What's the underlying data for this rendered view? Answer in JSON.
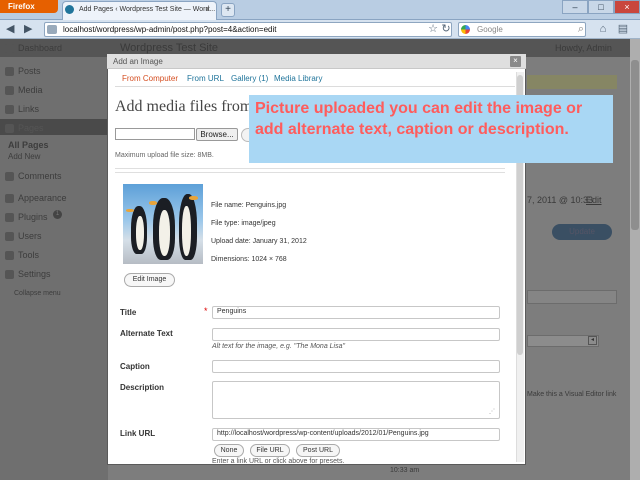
{
  "browser": {
    "menu_button": "Firefox",
    "tab_title": "Add Pages ‹ Wordpress Test Site — Word...",
    "tab_close": "×",
    "new_tab": "+",
    "url": "localhost/wordpress/wp-admin/post.php?post=4&action=edit",
    "search_placeholder": "Google",
    "window_buttons": [
      "–",
      "□",
      "×"
    ]
  },
  "wp_admin": {
    "site_title": "Wordpress Test Site",
    "howdy": "Howdy, Admin",
    "sidebar": [
      "Dashboard",
      "Posts",
      "Media",
      "Links",
      "Pages",
      "All Pages",
      "Add New",
      "Comments",
      "Appearance",
      "Plugins",
      "Users",
      "Tools",
      "Settings",
      "Collapse menu"
    ],
    "plugins_badge": "1",
    "right_date": "7, 2011 @ 10:33",
    "right_date_edit": "Edit",
    "update_button": "Update",
    "right_link": "Make this a Visual Editor link",
    "footer_time": "10:33 am"
  },
  "modal": {
    "title": "Add an Image",
    "tabs": [
      "From Computer",
      "From URL",
      "Gallery (1)",
      "Media Library"
    ],
    "heading": "Add media files from your computer",
    "browse_label": "Browse...",
    "max_size": "Maximum upload file size: 8MB.",
    "file_name": "File name: Penguins.jpg",
    "file_type": "File type: image/jpeg",
    "upload_date": "Upload date: January 31, 2012",
    "dimensions": "Dimensions: 1024 × 768",
    "edit_image": "Edit Image",
    "fields": {
      "title_label": "Title",
      "title_value": "Penguins",
      "alt_label": "Alternate Text",
      "alt_help": "Alt text for the image, e.g. \"The Mona Lisa\"",
      "caption_label": "Caption",
      "description_label": "Description",
      "link_label": "Link URL",
      "link_value": "http://localhost/wordpress/wp-content/uploads/2012/01/Penguins.jpg",
      "link_help": "Enter a link URL or click above for presets."
    },
    "link_buttons": [
      "None",
      "File URL",
      "Post URL"
    ]
  },
  "callout": {
    "text": "Picture uploaded you can edit the image or add alternate text, caption or description."
  },
  "colors": {
    "firefox_orange": "#e66000",
    "link_blue": "#21759b",
    "callout_bg": "#a9d7f4",
    "callout_text": "#ff5c5c"
  }
}
